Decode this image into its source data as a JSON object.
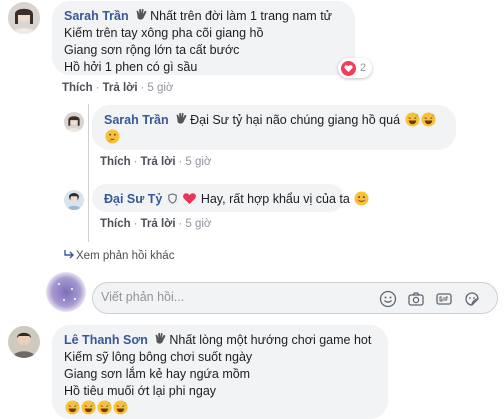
{
  "comment1": {
    "author": "Sarah Trần",
    "lines": [
      "Nhất trên đời làm 1 trang nam tử",
      "Kiếm trên tay xông pha cõi giang hồ",
      "Giang sơn rộng lớn ta cất bước",
      "Hồ hởi 1 phen có gì sầu"
    ],
    "reaction_count": "2",
    "like": "Thích",
    "reply": "Trả lời",
    "time": "5 giờ"
  },
  "reply1": {
    "author": "Sarah Trần",
    "text": "Đại Sư tỷ hại não chúng giang hồ quá",
    "like": "Thích",
    "reply": "Trả lời",
    "time": "5 giờ"
  },
  "reply2": {
    "author": "Đại Sư Tỷ",
    "text": "Hay, rất hợp khẩu vị của ta",
    "like": "Thích",
    "reply": "Trả lời",
    "time": "5 giờ"
  },
  "more_replies": "Xem phản hồi khác",
  "composer": {
    "placeholder": "Viết phản hồi..."
  },
  "comment2": {
    "author": "Lê Thanh Sơn",
    "lines": [
      "Nhất lòng một hướng chơi game hot",
      "Kiếm sỹ lông bông chơi suốt ngày",
      "Giang sơn lắm kẻ hay ngứa mồm",
      "Hồ tiêu muối ớt lại phi ngay"
    ]
  },
  "colors": {
    "link": "#385898",
    "bubble": "#f2f3f5",
    "heart": "#f33e58"
  }
}
